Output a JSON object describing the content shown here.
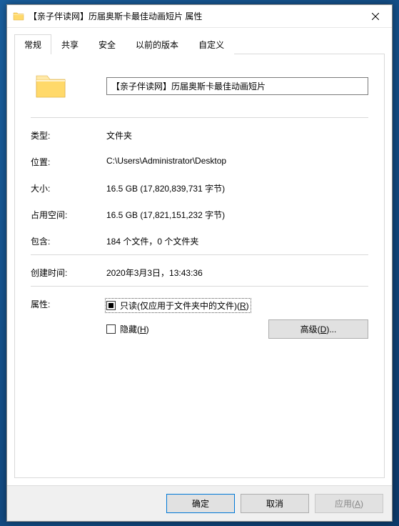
{
  "window": {
    "title": "【亲子伴读网】历届奥斯卡最佳动画短片 属性"
  },
  "tabs": {
    "general": "常规",
    "sharing": "共享",
    "security": "安全",
    "previous": "以前的版本",
    "customize": "自定义"
  },
  "general": {
    "name": "【亲子伴读网】历届奥斯卡最佳动画短片",
    "type_label": "类型:",
    "type_value": "文件夹",
    "location_label": "位置:",
    "location_value": "C:\\Users\\Administrator\\Desktop",
    "size_label": "大小:",
    "size_value": "16.5 GB (17,820,839,731 字节)",
    "sizeondisk_label": "占用空间:",
    "sizeondisk_value": "16.5 GB (17,821,151,232 字节)",
    "contains_label": "包含:",
    "contains_value": "184 个文件，0 个文件夹",
    "created_label": "创建时间:",
    "created_value": "2020年3月3日，13:43:36",
    "attr_label": "属性:",
    "readonly_pre": "只读(仅应用于文件夹中的文件)(",
    "readonly_key": "R",
    "readonly_post": ")",
    "hidden_pre": "隐藏(",
    "hidden_key": "H",
    "hidden_post": ")",
    "advanced_pre": "高级(",
    "advanced_key": "D",
    "advanced_post": ")..."
  },
  "footer": {
    "ok": "确定",
    "cancel": "取消",
    "apply_pre": "应用(",
    "apply_key": "A",
    "apply_post": ")"
  }
}
